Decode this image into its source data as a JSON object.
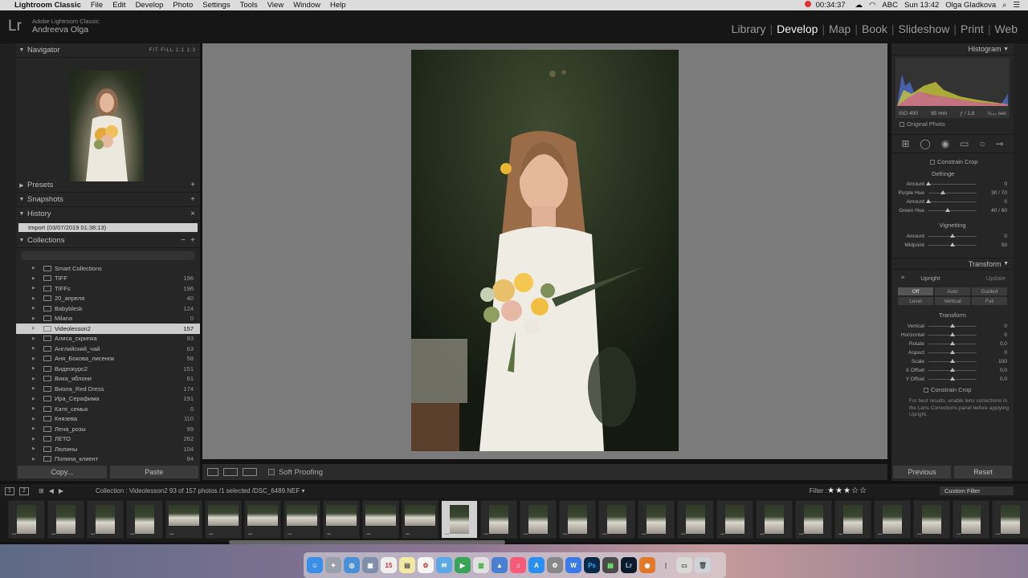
{
  "menubar": {
    "app": "Lightroom Classic",
    "items": [
      "File",
      "Edit",
      "Develop",
      "Photo",
      "Settings",
      "Tools",
      "View",
      "Window",
      "Help"
    ],
    "record_time": "00:34:37",
    "keyboard": "ABC",
    "clock": "Sun 13:42",
    "user": "Olga Gladkova"
  },
  "header": {
    "logo": "Lr",
    "product": "Adobe Lightroom Classic",
    "catalog_owner": "Andreeva Olga",
    "modules": [
      "Library",
      "Develop",
      "Map",
      "Book",
      "Slideshow",
      "Print",
      "Web"
    ],
    "active_module": "Develop"
  },
  "left": {
    "navigator": {
      "title": "Navigator",
      "options": "FIT  FILL  1:1  1:3"
    },
    "presets": "Presets",
    "snapshots": "Snapshots",
    "history": {
      "title": "History",
      "item": "Import (03/07/2019 01:38:13)"
    },
    "collections": {
      "title": "Collections",
      "items": [
        {
          "name": "Smart Collections",
          "count": ""
        },
        {
          "name": "TIFF",
          "count": "196"
        },
        {
          "name": "TIFFs",
          "count": "196"
        },
        {
          "name": "20_апреля",
          "count": "40"
        },
        {
          "name": "Babyblesk",
          "count": "124"
        },
        {
          "name": "Milana",
          "count": "0"
        },
        {
          "name": "Videolesson2",
          "count": "157"
        },
        {
          "name": "Алиса_скрипка",
          "count": "93"
        },
        {
          "name": "Английский_чай",
          "count": "63"
        },
        {
          "name": "Аня_Бокова_лисенок",
          "count": "58"
        },
        {
          "name": "Видеокурс2",
          "count": "151"
        },
        {
          "name": "Вика_яблони",
          "count": "61"
        },
        {
          "name": "Виола_Red Dress",
          "count": "174"
        },
        {
          "name": "Ира_Серафима",
          "count": "191"
        },
        {
          "name": "Катя_семья",
          "count": "0"
        },
        {
          "name": "Князева",
          "count": "110"
        },
        {
          "name": "Лена_розы",
          "count": "99"
        },
        {
          "name": "ЛЕТО",
          "count": "262"
        },
        {
          "name": "Люпины",
          "count": "104"
        },
        {
          "name": "Полина_клиент",
          "count": "84"
        }
      ],
      "selected_index": 6
    },
    "copy_btn": "Copy...",
    "paste_btn": "Paste"
  },
  "toolbar": {
    "soft_proofing": "Soft Proofing"
  },
  "right": {
    "histogram": {
      "title": "Histogram",
      "iso": "ISO 400",
      "lens": "85 mm",
      "aperture": "ƒ / 1,8",
      "shutter": "¹⁄₅₀₀ sec",
      "original": "Original Photo"
    },
    "constrain_crop": "Constrain Crop",
    "defringe": {
      "title": "Defringe",
      "rows": [
        {
          "label": "Amount",
          "value": "0"
        },
        {
          "label": "Purple Hue",
          "value": "30 / 70"
        },
        {
          "label": "Amount",
          "value": "0"
        },
        {
          "label": "Green Hue",
          "value": "40 / 60"
        }
      ]
    },
    "vignetting": {
      "title": "Vignetting",
      "rows": [
        {
          "label": "Amount",
          "value": "0"
        },
        {
          "label": "Midpoint",
          "value": "50"
        }
      ]
    },
    "transform": {
      "title": "Transform",
      "upright": "Upright",
      "update": "Update",
      "upright_btns1": [
        "Off",
        "Auto",
        "Guided"
      ],
      "upright_btns2": [
        "Level",
        "Vertical",
        "Full"
      ],
      "subtitle": "Transform",
      "rows": [
        {
          "label": "Vertical",
          "value": "0"
        },
        {
          "label": "Horizontal",
          "value": "0"
        },
        {
          "label": "Rotate",
          "value": "0,0"
        },
        {
          "label": "Aspect",
          "value": "0"
        },
        {
          "label": "Scale",
          "value": "100"
        },
        {
          "label": "X Offset",
          "value": "0,0"
        },
        {
          "label": "Y Offset",
          "value": "0,0"
        }
      ],
      "constrain": "Constrain Crop",
      "note": "For best results, enable lens corrections in the Lens Corrections panel before applying Upright."
    },
    "previous_btn": "Previous",
    "reset_btn": "Reset"
  },
  "filmbar": {
    "pages": [
      "1",
      "2"
    ],
    "path": "Collection : Videolesson2     93 of 157 photos /1 selected /DSC_6489.NEF ▾",
    "filter_label": "Filter :",
    "stars": "★★★☆☆",
    "custom_filter": "Custom Filter"
  },
  "colors": {
    "accent": "#f0f0f0",
    "panel": "#262626",
    "canvas": "#7b7b7b"
  }
}
